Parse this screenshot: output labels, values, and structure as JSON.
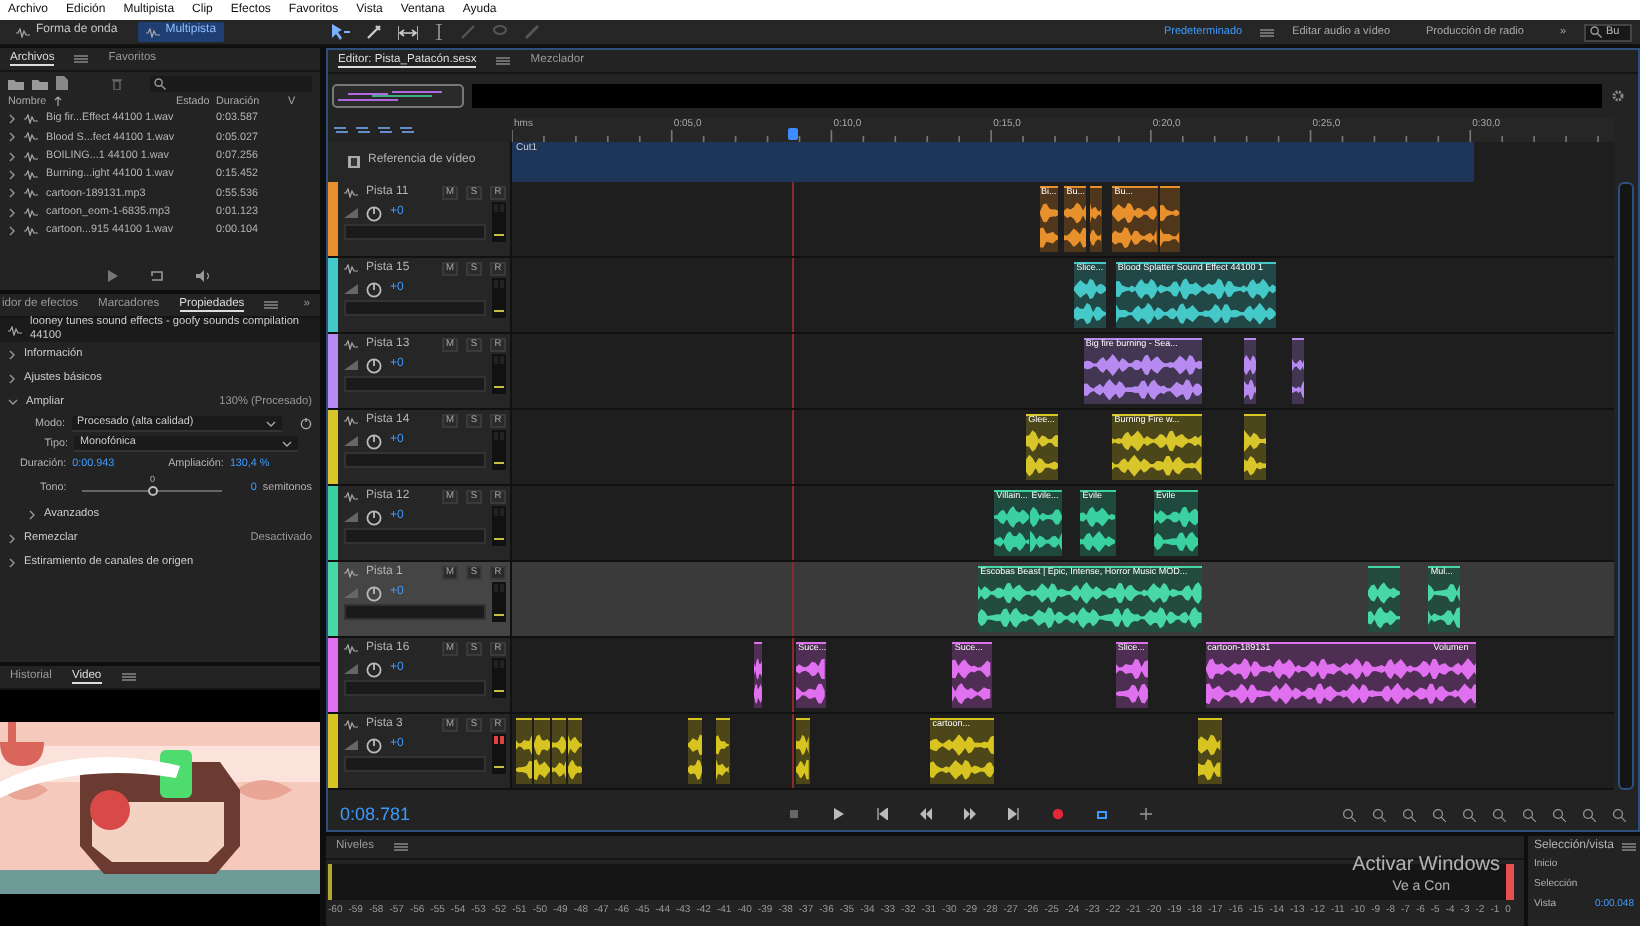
{
  "menu": [
    "Archivo",
    "Edición",
    "Multipista",
    "Clip",
    "Efectos",
    "Favoritos",
    "Vista",
    "Ventana",
    "Ayuda"
  ],
  "modes": [
    {
      "label": "Forma de onda",
      "selected": false
    },
    {
      "label": "Multipista",
      "selected": true
    }
  ],
  "workspaces": [
    {
      "label": "Predeterminado",
      "selected": true
    },
    {
      "label": "Editar audio a vídeo",
      "selected": false
    },
    {
      "label": "Producción de radio",
      "selected": false
    }
  ],
  "workspace_more": "»",
  "search": {
    "value": "Bu"
  },
  "files_panel": {
    "tabs": [
      {
        "label": "Archivos",
        "selected": true
      },
      {
        "label": "Favoritos",
        "selected": false
      }
    ],
    "columns": [
      "Nombre",
      "Estado",
      "Duración",
      "V"
    ],
    "rows": [
      {
        "name": "Big fir...Effect 44100 1.wav",
        "duration": "0:03.587"
      },
      {
        "name": "Blood S...fect 44100 1.wav",
        "duration": "0:05.027"
      },
      {
        "name": "BOILING...1 44100 1.wav",
        "duration": "0:07.256"
      },
      {
        "name": "Burning...ight 44100 1.wav",
        "duration": "0:15.452"
      },
      {
        "name": "cartoon-189131.mp3",
        "duration": "0:55.536"
      },
      {
        "name": "cartoon_eom-1-6835.mp3",
        "duration": "0:01.123"
      },
      {
        "name": "cartoon...915 44100 1.wav",
        "duration": "0:00.104"
      }
    ]
  },
  "properties_panel": {
    "tabs": [
      {
        "label": "idor de efectos",
        "selected": false
      },
      {
        "label": "Marcadores",
        "selected": false
      },
      {
        "label": "Propiedades",
        "selected": true
      }
    ],
    "more": "»",
    "file": "looney tunes sound effects - goofy sounds compilation 44100",
    "sections": [
      {
        "title": "Información",
        "expanded": false
      },
      {
        "title": "Ajustes básicos",
        "expanded": false
      },
      {
        "title": "Ampliar",
        "expanded": true,
        "value": "130% (Procesado)",
        "mode": {
          "label": "Modo:",
          "value": "Procesado (alta calidad)"
        },
        "type": {
          "label": "Tipo:",
          "value": "Monofónica"
        },
        "duration": {
          "label": "Duración:",
          "value": "0:00.943"
        },
        "amount": {
          "label": "Ampliación:",
          "value": "130,4 %"
        },
        "pitch": {
          "label": "Tono:",
          "thumb_label": "0",
          "level": 0.5,
          "value": "0",
          "unit": "semitonos"
        },
        "advanced": {
          "title": "Avanzados",
          "expanded": false
        }
      },
      {
        "title": "Remezclar",
        "expanded": false,
        "value": "Desactivado"
      },
      {
        "title": "Estiramiento de canales de origen",
        "expanded": false
      }
    ]
  },
  "video_panel": {
    "tabs": [
      {
        "label": "Historial",
        "selected": false
      },
      {
        "label": "Video",
        "selected": true
      }
    ],
    "kind": "picture"
  },
  "editor": {
    "tabs": [
      {
        "label": "Editor: Pista_Patacón.sesx",
        "selected": true
      },
      {
        "label": "Mezclador",
        "selected": false
      }
    ],
    "ruler": [
      "hms",
      "0:05,0",
      "0:10,0",
      "0:15,0",
      "0:20,0",
      "0:25,0",
      "0:30,0"
    ],
    "video_reference": {
      "label": "Referencia de vídeo",
      "clip": "Cut1"
    },
    "tracks": [
      {
        "name": "Pista 11",
        "color": "#e8902c",
        "selected": false,
        "clipping": false,
        "volume": "+0",
        "buttons": [
          "M",
          "S",
          "R"
        ],
        "clips": [
          {
            "kind": "audio",
            "title": "Bi..."
          },
          {
            "kind": "audio",
            "title": "Bu..."
          },
          {
            "kind": "audio"
          },
          {
            "kind": "audio",
            "title": "Bu..."
          },
          {
            "kind": "audio"
          }
        ]
      },
      {
        "name": "Pista 15",
        "color": "#45c8c8",
        "selected": false,
        "clipping": false,
        "volume": "+0",
        "buttons": [
          "M",
          "S",
          "R"
        ],
        "clips": [
          {
            "kind": "audio",
            "title": "Slice..."
          },
          {
            "kind": "audio",
            "title": "Blood Splatter Sound Effect 44100 1"
          }
        ]
      },
      {
        "name": "Pista 13",
        "color": "#b68af0",
        "selected": false,
        "clipping": false,
        "volume": "+0",
        "buttons": [
          "M",
          "S",
          "R"
        ],
        "clips": [
          {
            "kind": "audio",
            "title": "Big fire burning - Sea..."
          },
          {
            "kind": "audio"
          },
          {
            "kind": "audio"
          }
        ]
      },
      {
        "name": "Pista 14",
        "color": "#d8c52a",
        "selected": false,
        "clipping": false,
        "volume": "+0",
        "buttons": [
          "M",
          "S",
          "R"
        ],
        "clips": [
          {
            "kind": "audio",
            "title": "Glee..."
          },
          {
            "kind": "audio",
            "title": "Burning Fire w..."
          },
          {
            "kind": "audio"
          }
        ]
      },
      {
        "name": "Pista 12",
        "color": "#3ad0a0",
        "selected": false,
        "clipping": false,
        "volume": "+0",
        "buttons": [
          "M",
          "S",
          "R"
        ],
        "clips": [
          {
            "kind": "audio",
            "title": "Villain..."
          },
          {
            "kind": "audio",
            "title": "Evile..."
          },
          {
            "kind": "audio",
            "title": "Evile"
          },
          {
            "kind": "audio",
            "title": "Evile"
          }
        ]
      },
      {
        "name": "Pista 1",
        "color": "#48d8a8",
        "selected": true,
        "clipping": false,
        "volume": "+0",
        "buttons": [
          "M",
          "S",
          "R"
        ],
        "clips": [
          {
            "kind": "audio",
            "title": "Escobas Beast | Epic, Intense, Horror Music MOD..."
          },
          {
            "kind": "audio"
          },
          {
            "kind": "audio",
            "title": "Mul..."
          }
        ]
      },
      {
        "name": "Pista 16",
        "color": "#e070f0",
        "selected": false,
        "clipping": false,
        "volume": "+0",
        "buttons": [
          "M",
          "S",
          "R"
        ],
        "clips": [
          {
            "kind": "audio"
          },
          {
            "kind": "audio",
            "title": "Suce..."
          },
          {
            "kind": "audio",
            "title": "Suce..."
          },
          {
            "kind": "audio",
            "title": "Slice..."
          },
          {
            "kind": "audio",
            "title": "cartoon-189131",
            "extra": "Volumen"
          }
        ]
      },
      {
        "name": "Pista 3",
        "color": "#d8c420",
        "selected": false,
        "clipping": true,
        "volume": "+0",
        "buttons": [
          "M",
          "S",
          "R"
        ],
        "clips": [
          {
            "kind": "audio"
          },
          {
            "kind": "audio"
          },
          {
            "kind": "audio"
          },
          {
            "kind": "audio"
          },
          {
            "kind": "audio"
          },
          {
            "kind": "audio"
          },
          {
            "kind": "audio"
          },
          {
            "kind": "audio",
            "title": "cartoon..."
          },
          {
            "kind": "audio"
          }
        ]
      }
    ],
    "time": "0:08.781"
  },
  "levels": {
    "title": "Niveles",
    "scale": [
      "-60",
      "-59",
      "-58",
      "-57",
      "-56",
      "-55",
      "-54",
      "-53",
      "-52",
      "-51",
      "-50",
      "-49",
      "-48",
      "-47",
      "-46",
      "-45",
      "-44",
      "-43",
      "-42",
      "-41",
      "-40",
      "-39",
      "-38",
      "-37",
      "-36",
      "-35",
      "-34",
      "-33",
      "-32",
      "-31",
      "-30",
      "-29",
      "-28",
      "-27",
      "-26",
      "-25",
      "-24",
      "-23",
      "-22",
      "-21",
      "-20",
      "-19",
      "-18",
      "-17",
      "-16",
      "-15",
      "-14",
      "-13",
      "-12",
      "-11",
      "-10",
      "-9",
      "-8",
      "-7",
      "-6",
      "-5",
      "-4",
      "-3",
      "-2",
      "-1",
      "0"
    ]
  },
  "selection_panel": {
    "title": "Selección/vista",
    "rows": [
      {
        "label": "Inicio"
      },
      {
        "label": "Selección"
      },
      {
        "label": "Vista",
        "value": "0:00.048"
      }
    ]
  },
  "activation_notice": {
    "title": "Activar Windows",
    "text": "Ve a Con"
  }
}
